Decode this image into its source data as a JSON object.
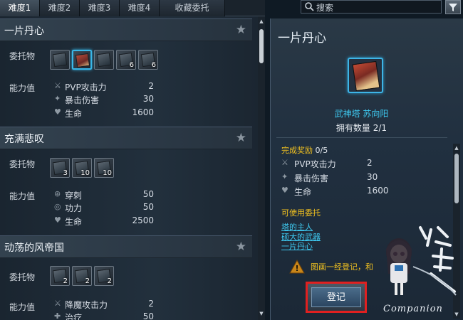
{
  "tabs": [
    "难度1",
    "难度2",
    "难度3",
    "难度4",
    "收藏委托"
  ],
  "search": {
    "placeholder": "搜索"
  },
  "list": {
    "cards": [
      {
        "title": "一片丹心",
        "consign_label": "委托物",
        "stats_label": "能力值",
        "items": [
          {
            "count": ""
          },
          {
            "count": "",
            "selected": true
          },
          {
            "count": ""
          },
          {
            "count": "6"
          },
          {
            "count": "6"
          }
        ],
        "stats": [
          {
            "icon": "pvp-attack-icon",
            "name": "PVP攻击力",
            "value": "2"
          },
          {
            "icon": "crit-damage-icon",
            "name": "暴击伤害",
            "value": "30"
          },
          {
            "icon": "heart-icon",
            "name": "生命",
            "value": "1600"
          }
        ]
      },
      {
        "title": "充满悲叹",
        "consign_label": "委托物",
        "stats_label": "能力值",
        "items": [
          {
            "count": "3"
          },
          {
            "count": "10"
          },
          {
            "count": "10"
          }
        ],
        "stats": [
          {
            "icon": "pierce-icon",
            "name": "穿刺",
            "value": "50"
          },
          {
            "icon": "skill-power-icon",
            "name": "功力",
            "value": "50"
          },
          {
            "icon": "heart-icon",
            "name": "生命",
            "value": "2500"
          }
        ]
      },
      {
        "title": "动荡的风帝国",
        "consign_label": "委托物",
        "stats_label": "能力值",
        "items": [
          {
            "count": "2"
          },
          {
            "count": "2"
          },
          {
            "count": "2"
          }
        ],
        "stats": [
          {
            "icon": "demon-attack-icon",
            "name": "降魔攻击力",
            "value": "2"
          },
          {
            "icon": "heal-icon",
            "name": "治疗",
            "value": "50"
          }
        ]
      }
    ]
  },
  "detail": {
    "title": "一片丹心",
    "item_name": "武神塔 苏向阳",
    "owned": "拥有数量 2/1",
    "reward_key": "完成奖励",
    "reward_val": "0/5",
    "stats": [
      {
        "icon": "pvp-attack-icon",
        "name": "PVP攻击力",
        "value": "2"
      },
      {
        "icon": "crit-damage-icon",
        "name": "暴击伤害",
        "value": "30"
      },
      {
        "icon": "heart-icon",
        "name": "生命",
        "value": "1600"
      }
    ],
    "usable_label": "可使用委托",
    "links": [
      "塔的主人",
      "硕大的武器",
      "一片丹心"
    ],
    "warning": "图画一经登记，和",
    "register_button": "登记"
  },
  "mascot": {
    "caption": "Companion",
    "watermark": "攻略组"
  },
  "colors": {
    "accent": "#3ec9f0",
    "gold": "#f0c020",
    "highlight": "#e02020"
  }
}
